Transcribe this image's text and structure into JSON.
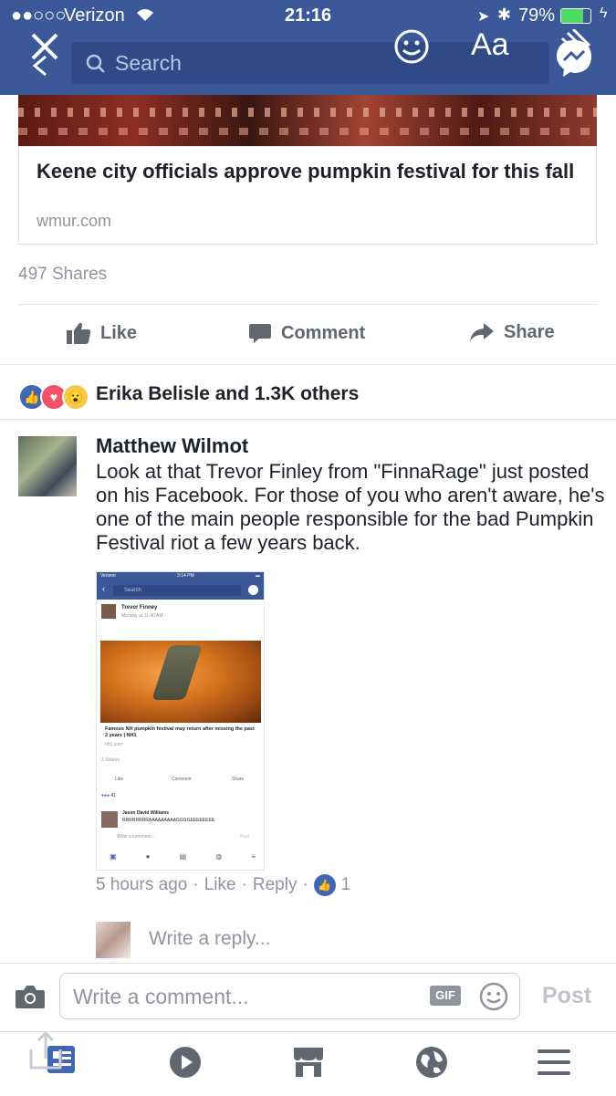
{
  "status_bar": {
    "carrier": "Verizon",
    "time": "21:16",
    "battery": "79%"
  },
  "header": {
    "search_placeholder": "Search",
    "text_tool_label": "Aa"
  },
  "link_card": {
    "title": "Keene city officials approve pumpkin festival for this fall",
    "domain": "wmur.com"
  },
  "post": {
    "shares": "497 Shares",
    "actions": {
      "like": "Like",
      "comment": "Comment",
      "share": "Share"
    },
    "reactions_text": "Erika Belisle and 1.3K others"
  },
  "comment": {
    "author": "Matthew Wilmot",
    "text": "Look at that Trevor Finley from \"FinnaRage\" just posted on his Facebook. For those of you who aren't aware, he's one of the main people responsible for the bad Pumpkin Festival riot a few years back.",
    "time": "5 hours ago",
    "like": "Like",
    "reply": "Reply",
    "like_count": "1"
  },
  "embedded_screenshot": {
    "carrier": "Verizon",
    "time": "3:14 PM",
    "search": "Search",
    "author": "Trevor Finney",
    "post_time": "Monday at 11:40 AM",
    "link_title": "Famous NH pumpkin festival may return after missing the past 2 years | NH1",
    "link_domain": "nh1.com",
    "shares": "3 Shares",
    "like": "Like",
    "comment": "Comment",
    "share": "Share",
    "reactions": "41",
    "commenter": "Jason David Williams",
    "comment_text": "RRRRRRRRAAAAAAAAAGGGGEEEEEEEE.",
    "write_comment": "Write a comment...",
    "post": "Post"
  },
  "reply": {
    "placeholder": "Write a reply..."
  },
  "composer": {
    "placeholder": "Write a comment...",
    "gif": "GIF",
    "post": "Post"
  },
  "colors": {
    "brand": "#3b5998",
    "like_blue": "#4267b2"
  }
}
